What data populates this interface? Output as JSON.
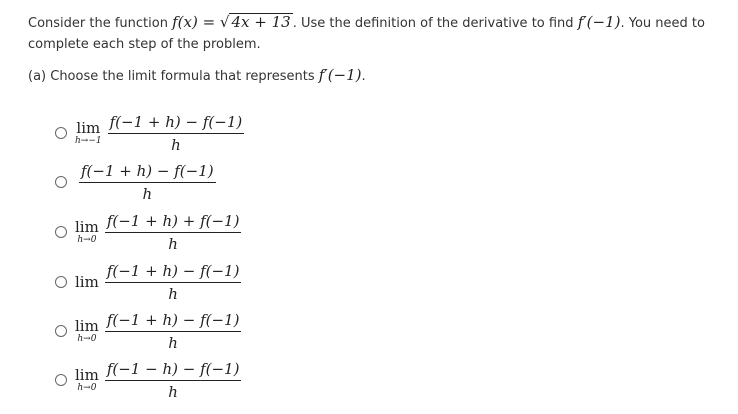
{
  "prompt": {
    "text_before": "Consider the function ",
    "function_lhs": "f(x) = ",
    "function_radicand": "4x + 13",
    "text_middle": ". Use the definition of the derivative to find ",
    "target": "f′(−1)",
    "text_after": ". You need to complete each step of the problem."
  },
  "part_a": {
    "label": "(a) Choose the limit formula that represents ",
    "target": "f′(−1)",
    "end": "."
  },
  "options": [
    {
      "lim": "lim",
      "sub": "h→−1",
      "numerator": "f(−1 + h) − f(−1)",
      "denominator": "h"
    },
    {
      "lim": "",
      "sub": "",
      "numerator": "f(−1 + h) − f(−1)",
      "denominator": "h"
    },
    {
      "lim": "lim",
      "sub": "h→0",
      "numerator": "f(−1 + h) + f(−1)",
      "denominator": "h"
    },
    {
      "lim": "lim",
      "sub": "",
      "numerator": "f(−1 + h) − f(−1)",
      "denominator": "h"
    },
    {
      "lim": "lim",
      "sub": "h→0",
      "numerator": "f(−1 + h) − f(−1)",
      "denominator": "h"
    },
    {
      "lim": "lim",
      "sub": "h→0",
      "numerator": "f(−1 − h) − f(−1)",
      "denominator": "h"
    }
  ]
}
